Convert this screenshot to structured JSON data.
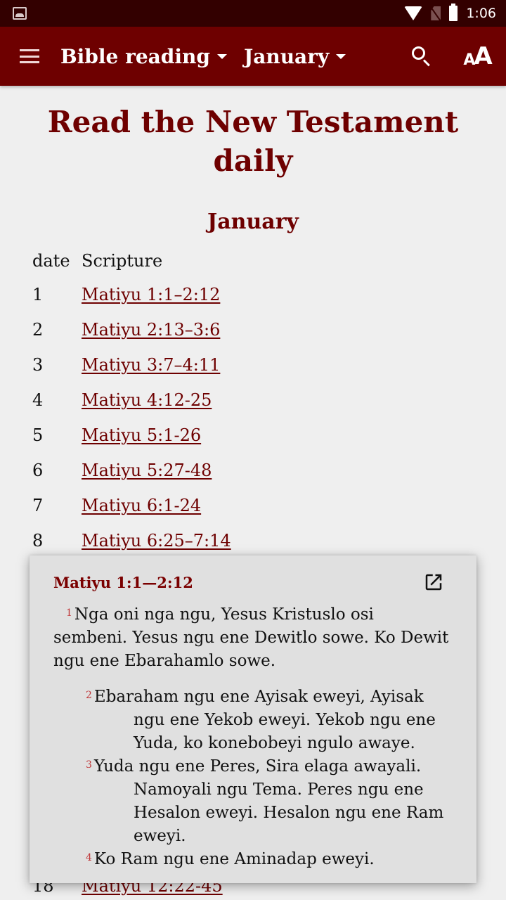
{
  "status_bar": {
    "time": "1:06",
    "icons": [
      "image-notification-icon",
      "wifi-icon",
      "no-sim-icon",
      "battery-icon"
    ]
  },
  "app_bar": {
    "menu_icon": "hamburger-menu-icon",
    "book_dropdown": "Bible reading",
    "month_dropdown": "January",
    "search_icon": "search-icon",
    "text_size_icon": "text-size-icon",
    "text_size_small": "A",
    "text_size_big": "A"
  },
  "page": {
    "title": "Read the New Testament daily",
    "month_heading": "January",
    "table": {
      "headers": {
        "date": "date",
        "scripture": "Scripture"
      },
      "rows": [
        {
          "date": "1",
          "scripture": "Matiyu 1:1–2:12"
        },
        {
          "date": "2",
          "scripture": "Matiyu 2:13–3:6"
        },
        {
          "date": "3",
          "scripture": "Matiyu 3:7–4:11"
        },
        {
          "date": "4",
          "scripture": "Matiyu 4:12-25"
        },
        {
          "date": "5",
          "scripture": "Matiyu 5:1-26"
        },
        {
          "date": "6",
          "scripture": "Matiyu 5:27-48"
        },
        {
          "date": "7",
          "scripture": "Matiyu 6:1-24"
        },
        {
          "date": "8",
          "scripture": "Matiyu 6:25–7:14"
        }
      ],
      "visible_row_below_popup": {
        "date": "18",
        "scripture": "Matiyu 12:22-45"
      }
    }
  },
  "popup": {
    "title": "Matiyu 1:1—2:12",
    "open_icon": "open-in-new-icon",
    "verses": [
      {
        "num": "1",
        "text": "Nga oni nga ngu, Yesus Kristuslo osi sembeni. Yesus ngu ene Dewitlo sowe. Ko Dewit ngu ene Ebarahamlo sowe."
      },
      {
        "num": "2",
        "text": "Ebaraham ngu ene Ayisak eweyi, Ayisak ngu ene Yekob eweyi. Yekob ngu ene Yuda, ko konebobeyi ngulo awaye."
      },
      {
        "num": "3",
        "text": "Yuda ngu ene Peres, Sira elaga awayali. Namoyali ngu Tema. Peres ngu ene Hesalon eweyi. Hesalon ngu ene Ram eweyi."
      },
      {
        "num": "4",
        "text": "Ko Ram ngu ene Aminadap eweyi."
      }
    ]
  },
  "colors": {
    "status_bar": "#330000",
    "app_bar": "#6e0000",
    "accent": "#6e0000",
    "verse_number": "#c0393b",
    "background": "#efefef",
    "popup_background": "#e0e0e0"
  }
}
